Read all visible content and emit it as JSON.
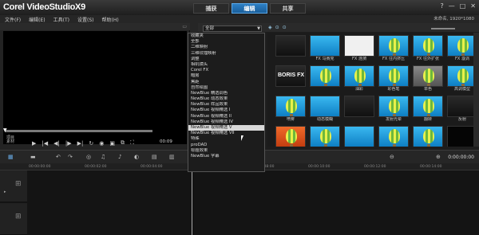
{
  "app": {
    "logo": "Corel VideoStudioX9"
  },
  "tabs": [
    {
      "label": "捕获",
      "active": false
    },
    {
      "label": "编辑",
      "active": true
    },
    {
      "label": "共享",
      "active": false
    }
  ],
  "window_controls": {
    "help": "?",
    "minimize": "—",
    "maximize": "□",
    "close": "✕"
  },
  "menu": [
    "文件(F)",
    "编辑(E)",
    "工具(T)",
    "设置(S)",
    "帮助(H)"
  ],
  "project_info": "未命名, 1920*1080",
  "preview": {
    "time_end": "00:00",
    "timecode": "00:09",
    "mode_a": "项目",
    "mode_b": "素材"
  },
  "library": {
    "gallery_value": "全部",
    "dropdown_options": [
      "收藏夹",
      "全部",
      "二维映射",
      "三维纹理映射",
      "调整",
      "相机镜头",
      "Corel FX",
      "暗房",
      "焦距",
      "自然绘图",
      "NewBlue 精选调色",
      "NewBlue 动态效果",
      "NewBlue 样品效果",
      "NewBlue 视频精选 I",
      "NewBlue 视频精选 II",
      "NewBlue 视频精选 IV",
      "NewBlue 视频精选 V",
      "NewBlue 视频精选 VII",
      "特殊",
      "proDAD",
      "标题效果",
      "NewBlue 字幕"
    ],
    "highlighted_option_index": 16,
    "thumbs": [
      {
        "label": "",
        "kind": "dark"
      },
      {
        "label": "FX 马赛克",
        "kind": "blue"
      },
      {
        "label": "FX 涟漪",
        "kind": "white"
      },
      {
        "label": "FX 往内挤压",
        "kind": "balloon"
      },
      {
        "label": "FX 往外扩张",
        "kind": "balloon"
      },
      {
        "label": "FX 漩涡",
        "kind": "balloon"
      },
      {
        "label": "",
        "kind": "boris"
      },
      {
        "label": "",
        "kind": "balloon"
      },
      {
        "label": "油彩",
        "kind": "balloon"
      },
      {
        "label": "彩色笔",
        "kind": "balloon"
      },
      {
        "label": "单色",
        "kind": "gray"
      },
      {
        "label": "高调模型",
        "kind": "balloon"
      },
      {
        "label": "喷雾",
        "kind": "balloon"
      },
      {
        "label": "动态模糊",
        "kind": "blue"
      },
      {
        "label": "",
        "kind": "dark"
      },
      {
        "label": "发射光晕",
        "kind": "balloon"
      },
      {
        "label": "翻转",
        "kind": "balloon"
      },
      {
        "label": "反射",
        "kind": "dark"
      },
      {
        "label": "反转",
        "kind": "orange"
      },
      {
        "label": "放大镜",
        "kind": "balloon"
      },
      {
        "label": "飞翔的字幕",
        "kind": "blue"
      },
      {
        "label": "",
        "kind": "balloon"
      },
      {
        "label": "",
        "kind": "balloon"
      },
      {
        "label": "",
        "kind": "black"
      },
      {
        "label": "",
        "kind": "balloon"
      },
      {
        "label": "",
        "kind": "balloon"
      },
      {
        "label": "",
        "kind": "dark"
      },
      {
        "label": "",
        "kind": "blue"
      }
    ]
  },
  "timeline": {
    "timecode": "0:00:00:00",
    "ruler": [
      "00:00:00:00",
      "00:00:02:00",
      "00:00:04:00",
      "00:00:06:00",
      "00:00:08:00",
      "00:00:10:00",
      "00:00:12:00",
      "00:00:14:00"
    ]
  },
  "colors": {
    "accent": "#2d7fc5",
    "thumb_blue": "#1a9ad8",
    "background": "#1d1d1d"
  }
}
